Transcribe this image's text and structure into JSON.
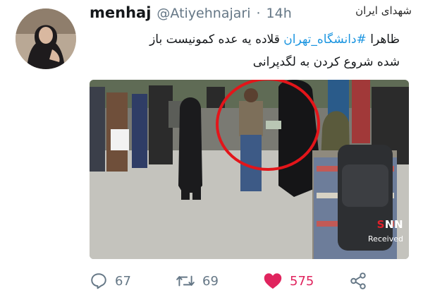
{
  "user": {
    "display_name": "menhaj",
    "handle": "@Atiyehnajari",
    "separator": "·",
    "time": "14h"
  },
  "watermark": "شهدای ایران",
  "tweet": {
    "line1_prefix": "ظاهرا ",
    "hashtag": "#دانشگاه_تهران",
    "line1_suffix": " قلاده یه عده کمونیست باز",
    "line2": "شده شروع کردن به لگدپرانی"
  },
  "media": {
    "logo_red": "S",
    "logo_rest": "NN",
    "received": "Received"
  },
  "actions": {
    "replies": "67",
    "retweets": "69",
    "likes": "575"
  },
  "colors": {
    "like": "#e0245e",
    "muted": "#657786",
    "hashtag": "#1b95e0",
    "highlight_circle": "#e3151a"
  },
  "icons": {
    "reply": "reply-icon",
    "retweet": "retweet-icon",
    "like": "heart-icon",
    "share": "share-icon"
  }
}
